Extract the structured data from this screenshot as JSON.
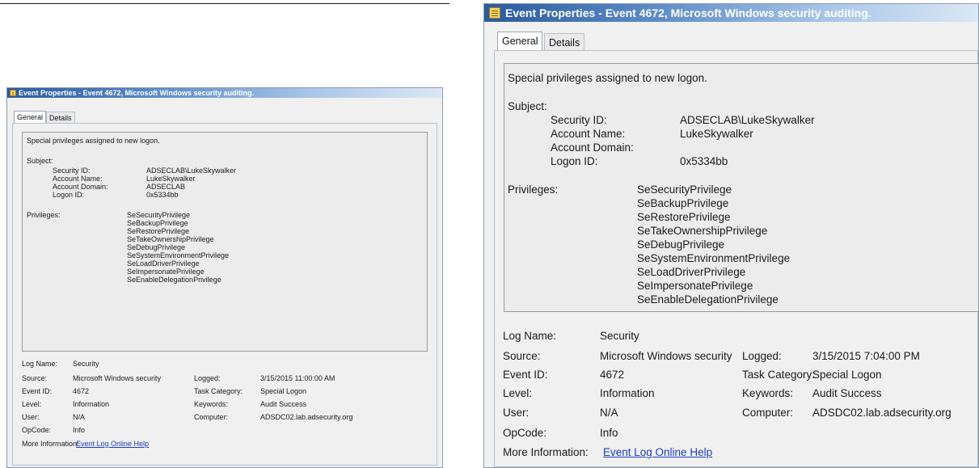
{
  "window": {
    "title": "Event Properties - Event 4672, Microsoft Windows security auditing.",
    "tabs": [
      "General",
      "Details"
    ],
    "selected_tab": "General"
  },
  "description": {
    "summary": "Special privileges assigned to new logon.",
    "subject_label": "Subject:",
    "subject_fields": [
      {
        "label": "Security ID:",
        "value": "ADSECLAB\\LukeSkywalker"
      },
      {
        "label": "Account Name:",
        "value": "LukeSkywalker"
      },
      {
        "label": "Account Domain:",
        "value": "ADSECLAB"
      },
      {
        "label": "Logon ID:",
        "value": "0x5334bb"
      }
    ],
    "privileges_label": "Privileges:",
    "privileges": [
      "SeSecurityPrivilege",
      "SeBackupPrivilege",
      "SeRestorePrivilege",
      "SeTakeOwnershipPrivilege",
      "SeDebugPrivilege",
      "SeSystemEnvironmentPrivilege",
      "SeLoadDriverPrivilege",
      "SeImpersonatePrivilege",
      "SeEnableDelegationPrivilege"
    ]
  },
  "details": {
    "log_name": {
      "label": "Log Name:",
      "value": "Security"
    },
    "source": {
      "label": "Source:",
      "value": "Microsoft Windows security"
    },
    "logged": {
      "label": "Logged:",
      "value": "3/15/2015 7:04:00 PM"
    },
    "event_id": {
      "label": "Event ID:",
      "value": "4672"
    },
    "task_category": {
      "label": "Task Category:",
      "value": "Special Logon"
    },
    "level": {
      "label": "Level:",
      "value": "Information"
    },
    "keywords": {
      "label": "Keywords:",
      "value": "Audit Success"
    },
    "user": {
      "label": "User:",
      "value": "N/A"
    },
    "computer": {
      "label": "Computer:",
      "value": "ADSDC02.lab.adsecurity.org"
    },
    "opcode": {
      "label": "OpCode:",
      "value": "Info"
    },
    "more_info": {
      "label": "More Information:",
      "link": "Event Log Online Help"
    }
  },
  "small_window_differences": {
    "logged_value": "3/15/2015 11:00:00 AM"
  },
  "colors": {
    "titlebar_dark": "#2a5a9e",
    "titlebar_light": "#dbe8f5",
    "window_bg": "#f0f0f0",
    "link": "#1a3fbf"
  }
}
